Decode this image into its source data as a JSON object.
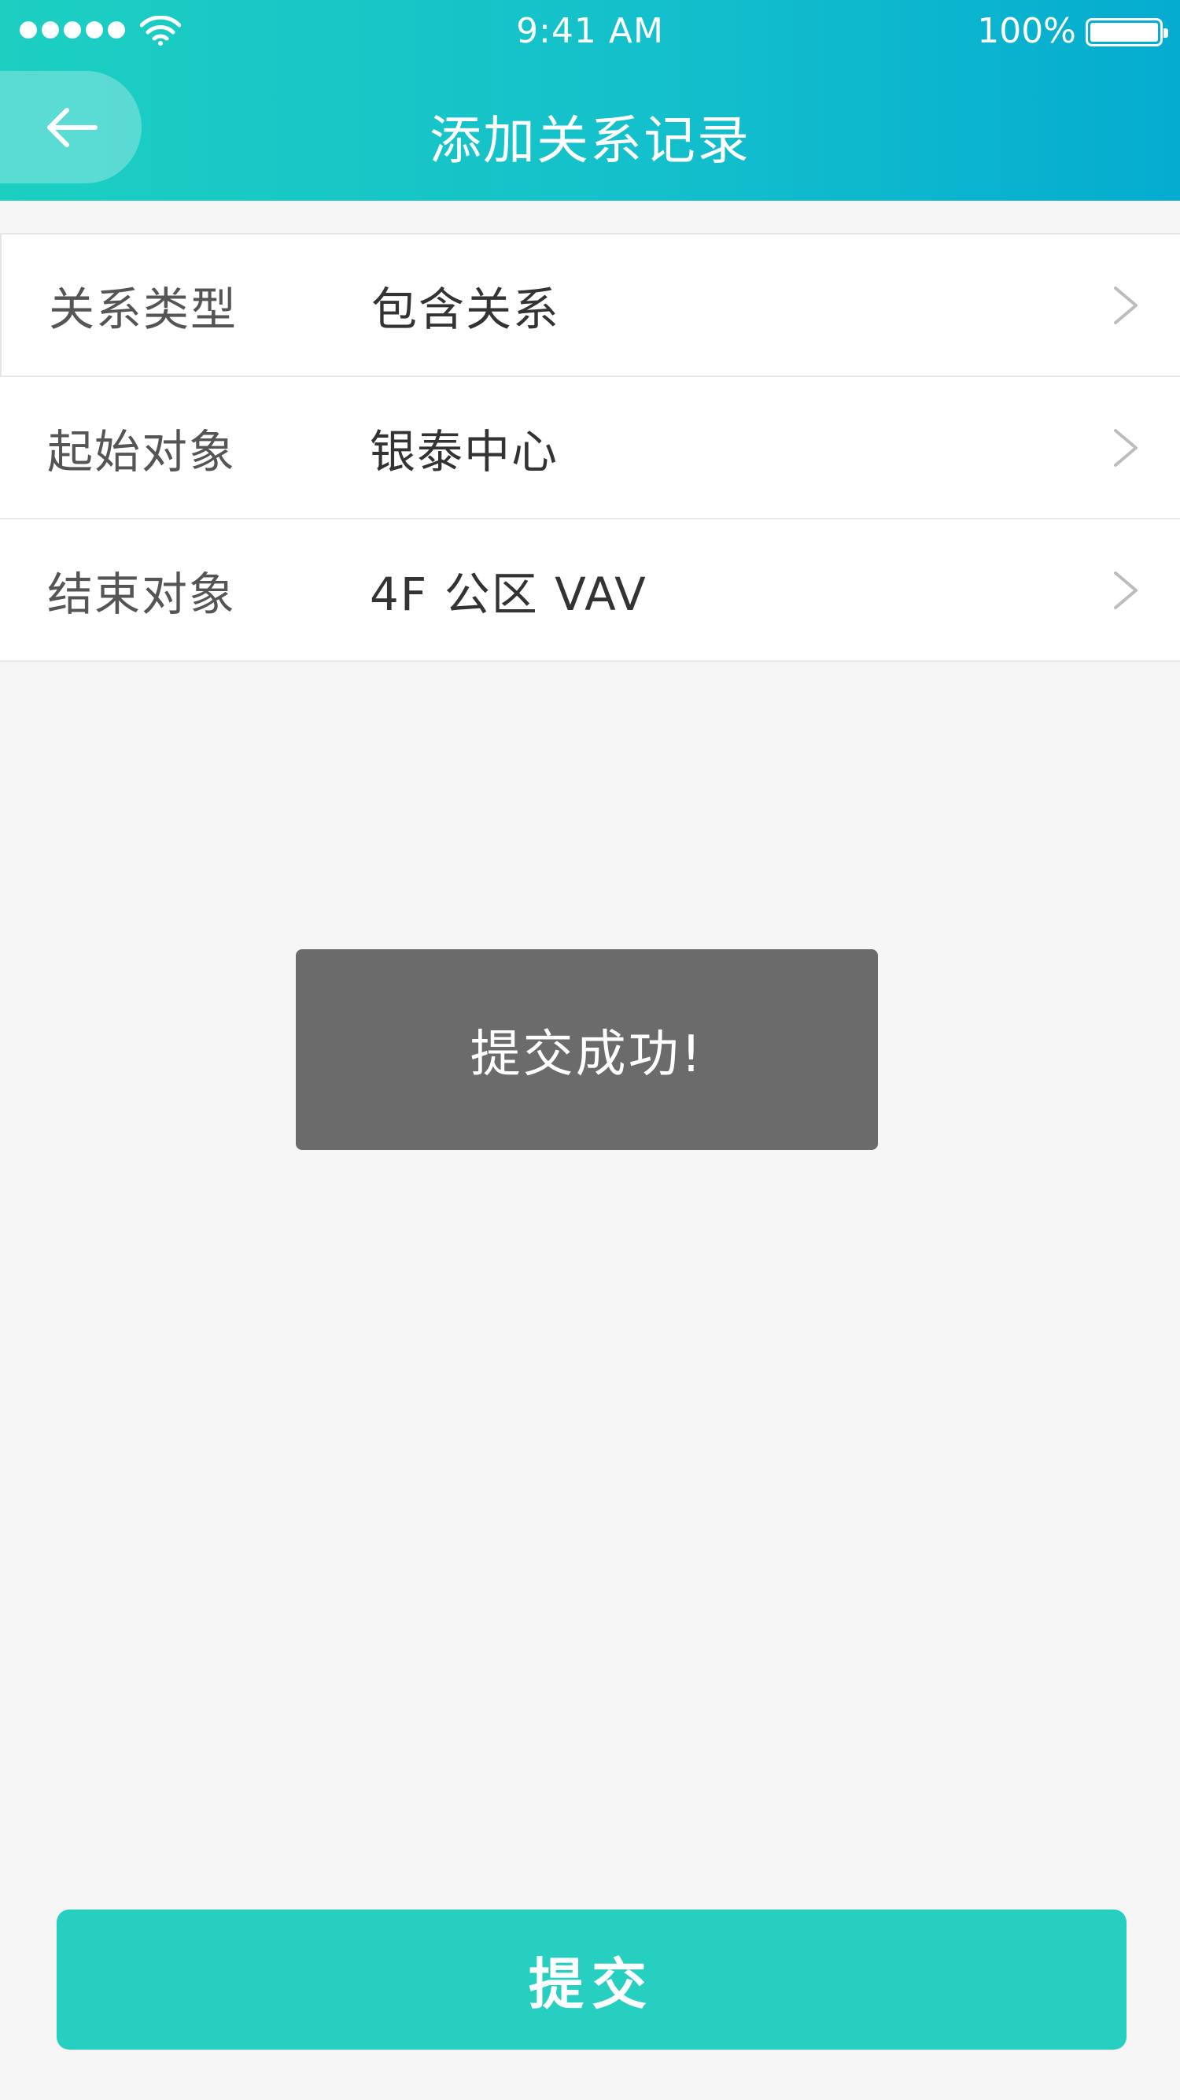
{
  "status_bar": {
    "time": "9:41 AM",
    "battery": "100%",
    "battery_level": 1.0,
    "signal_bars": 5
  },
  "header": {
    "title": "添加关系记录",
    "back_icon": "arrow-left-icon"
  },
  "form": {
    "rows": [
      {
        "label": "关系类型",
        "value": "包含关系",
        "icon": "chevron-right-icon"
      },
      {
        "label": "起始对象",
        "value": "银泰中心",
        "icon": "chevron-right-icon"
      },
      {
        "label": "结束对象",
        "value": "4F 公区 VAV",
        "icon": "chevron-right-icon"
      }
    ]
  },
  "toast": {
    "message": "提交成功!"
  },
  "footer": {
    "submit_label": "提交"
  },
  "colors": {
    "header_gradient_start": "#1ccfc1",
    "header_gradient_end": "#05acd0",
    "submit_button": "#27cfc0",
    "toast_bg": "#6b6b6b",
    "page_bg": "#f6f6f6"
  }
}
